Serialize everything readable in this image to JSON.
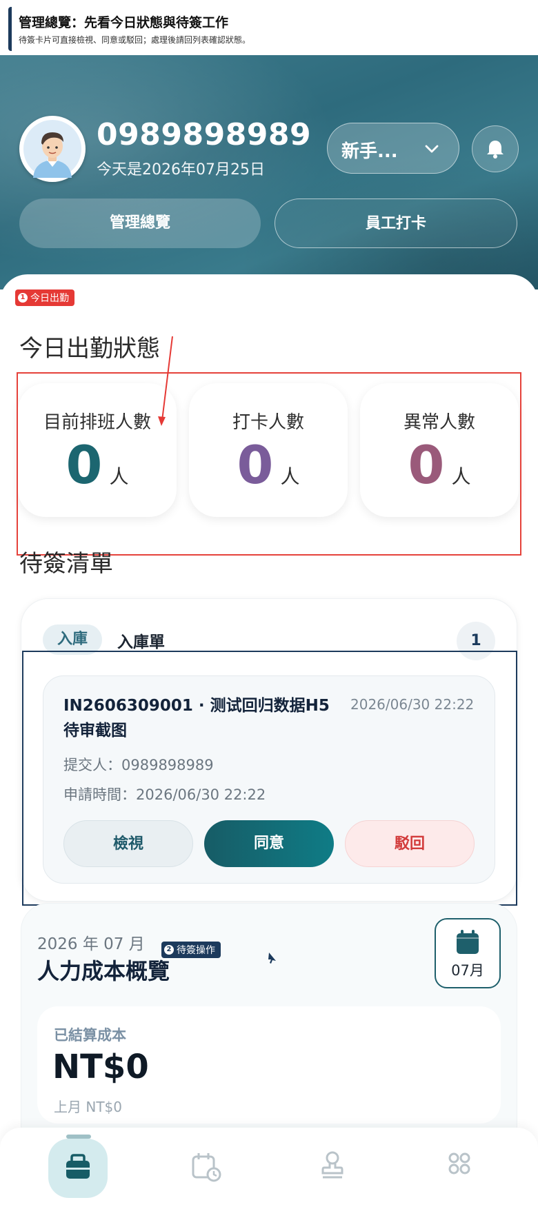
{
  "banner": {
    "title": "管理總覽：先看今日狀態與待簽工作",
    "subtitle": "待簽卡片可直接檢視、同意或駁回；處理後請回列表確認狀態。"
  },
  "header": {
    "user_name": "0989898989",
    "date_text": "今天是2026年07月25日",
    "store_select": "新手...",
    "tabs": [
      {
        "label": "管理總覽",
        "active": true
      },
      {
        "label": "員工打卡",
        "active": false
      }
    ]
  },
  "annotations": {
    "tag1": {
      "num": "1",
      "label": "今日出勤"
    },
    "tag2": {
      "num": "2",
      "label": "待簽操作"
    }
  },
  "attendance": {
    "title": "今日出勤狀態",
    "stats": [
      {
        "label": "目前排班人數",
        "value": "0",
        "unit": "人",
        "color": "#1c6670"
      },
      {
        "label": "打卡人數",
        "value": "0",
        "unit": "人",
        "color": "#7a5c9a"
      },
      {
        "label": "異常人數",
        "value": "0",
        "unit": "人",
        "color": "#9a5a7a"
      }
    ]
  },
  "pending": {
    "title": "待簽清單",
    "chip": "入庫",
    "heading": "入庫單",
    "count": "1",
    "item": {
      "title": "IN2606309001 · 测试回归数据H5待审截图",
      "time": "2026/06/30 22:22",
      "submitter": "提交人：0989898989",
      "applied": "申請時間：2026/06/30 22:22",
      "view_label": "檢視",
      "approve_label": "同意",
      "reject_label": "駁回"
    }
  },
  "cost": {
    "period": "2026 年 07 月",
    "title": "人力成本概覽",
    "month_button": "07月",
    "settled_label": "已結算成本",
    "settled_value": "NT$0",
    "last_month": "上月 NT$0"
  },
  "nav": {
    "items": [
      "briefcase-icon",
      "calendar-clock-icon",
      "stamp-icon",
      "grid-icon"
    ]
  },
  "colors": {
    "accent": "#1c6670",
    "annotation_red": "#e5413a",
    "annotation_navy": "#1c3a5c"
  }
}
